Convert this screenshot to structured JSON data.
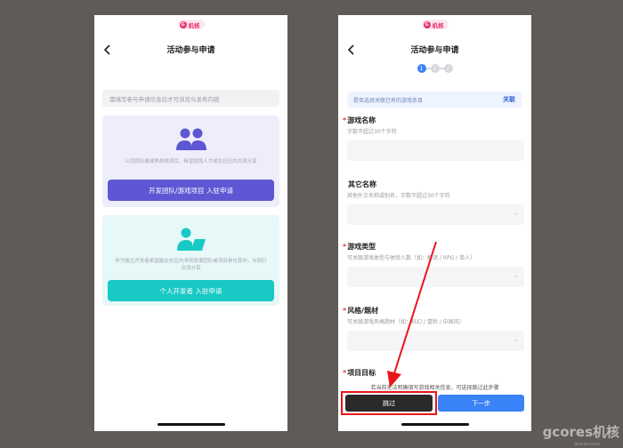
{
  "brand": {
    "logo_text": "机核",
    "logo_mark": "G",
    "accent": "#e8336b"
  },
  "left_screen": {
    "title": "活动参与申请",
    "back_icon": "chevron-left-icon",
    "hint": "需填写参与申请信息后才可浏览与发布内容",
    "team_card": {
      "icon": "team-icon",
      "description": "公司团队或或熟游戏项目，希望招揽人才或在社区内交流分享",
      "button": "开发团队/游戏项目 入驻申请",
      "color": "#5d57d4"
    },
    "indie_card": {
      "icon": "developer-icon",
      "description": "作为独立开发者希望能在社区内寻找靠谱团队或项目参与其中，与同行交流分享",
      "button": "个人开发者 入驻申请",
      "color": "#19c9c6"
    }
  },
  "right_screen": {
    "title": "活动参与申请",
    "steps": [
      "1",
      "2",
      "✓"
    ],
    "link_bar": {
      "text": "是否选择关联已有的游戏条目",
      "action": "关联"
    },
    "fields": [
      {
        "label": "游戏名称",
        "required": "*",
        "hint": "字数不超过30个字符"
      },
      {
        "label": "其它名称",
        "required": "",
        "hint": "其他外文名称或别名，字数不超过30个字符"
      },
      {
        "label": "游戏类型",
        "required": "*",
        "hint": "可关联游戏类型与体验人数（如：解谜 / RPG / 单人）"
      },
      {
        "label": "风格/题材",
        "required": "*",
        "hint": "可关联游戏风格题材（如：科幻 / 冒险 / 中国风）"
      },
      {
        "label": "项目目标",
        "required": "*",
        "hint": ""
      }
    ],
    "bottom": {
      "notice": "若当前无法明确填写游戏相关信息，可选择跳过此步骤",
      "skip": "跳过",
      "next": "下一步"
    }
  },
  "watermark": {
    "main": "gcores机核",
    "sub": "gcores.com"
  }
}
